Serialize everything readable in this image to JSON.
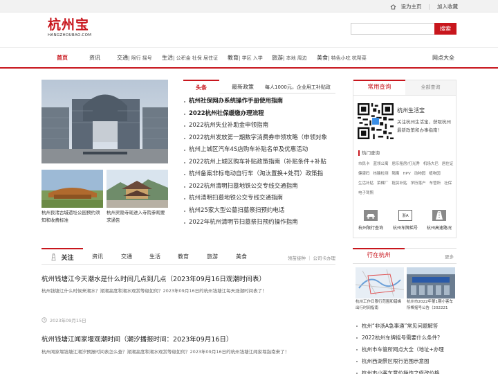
{
  "topbar": {
    "set_home": "设为主页",
    "add_fav": "加入收藏"
  },
  "logo": {
    "cn": "杭州宝",
    "en": "HANGZHOUBAO.COM"
  },
  "search": {
    "placeholder": "",
    "button": "搜索"
  },
  "nav": {
    "home": "首页",
    "news": "资讯",
    "traffic": "交通",
    "traffic_sub": "| 限行 摇号",
    "life": "生活",
    "life_sub": "| 公积金 社保 居住证",
    "edu": "教育",
    "edu_sub": "| 学区 入学",
    "travel": "旅游",
    "travel_sub": "| 本地 周边",
    "food": "美食",
    "food_sub": "| 特色小吃 杭帮菜",
    "sites": "网点大全"
  },
  "thumbs": [
    {
      "caption": "杭州良渚古城遗址公园预约须知和收费标准"
    },
    {
      "caption": "杭州灵隐寺现进入寺院参观要求通告"
    }
  ],
  "headline_tabs": {
    "active": "头条",
    "second": "最新政策",
    "sub": "每人1000元，企业用工补贴政"
  },
  "headlines": [
    {
      "text": "杭州社保网办系统操作手册使用指南",
      "bold": true
    },
    {
      "text": "2022杭州社保缓缴办理流程",
      "bold": true
    },
    {
      "text": "2022杭州失业补助金申领指南"
    },
    {
      "text": "2022杭州发放第一期数字消费券申领攻略（申领对象"
    },
    {
      "text": "杭州上城区汽车4S店购车补贴名单及优惠活动"
    },
    {
      "text": "2022杭州上城区购车补贴政策指南（补贴条件+补贴"
    },
    {
      "text": "杭州备案非标电动自行车（淘汰置换+处罚）政策指"
    },
    {
      "text": "2022杭州清明扫墓地铁公交专线交通指南"
    },
    {
      "text": "杭州清明扫墓地铁公交专线交通指南"
    },
    {
      "text": "杭州25家大型公墓扫墓祭扫预约电话"
    },
    {
      "text": "2022年杭州清明节扫墓祭扫预约操作指南"
    }
  ],
  "follow": {
    "active": "关注",
    "tabs": [
      "资讯",
      "交通",
      "生活",
      "教育",
      "旅游",
      "美食"
    ],
    "right": "领苗接种 ｜ 公司卡办理"
  },
  "articles": [
    {
      "title": "杭州钱塘江今天潮水是什么时间几点到几点（2023年09月16日观潮时间表）",
      "summary": "杭州钱塘江什么时候来潮水？潮潮高度和潮水观赏等级如何？2023年09月16日的杭州钱塘江每天涨潮时间表了！",
      "date": "2023年09月15日"
    },
    {
      "title": "杭州钱塘江闻家堰观潮时间（潮汐播报时间：2023年09月16日）",
      "summary": "杭州闻家堰钱塘江潮汐预报时间表怎么查？潮潮高度和潮水观赏等级如何？2023年09月16日的杭州钱塘江闻家堰指南来了！"
    }
  ],
  "sidebar": {
    "tab_active": "常用查询",
    "tab_other": "全部查询",
    "qr_title": "杭州生活宝",
    "qr_desc": "关注杭州生活宝，获取杭州最新政策和办事指南！",
    "hot_title": "热门查询",
    "hot": [
      "市民卡",
      "蓝领公寓",
      "居乐租房/打光秀",
      "机场大巴",
      "居住证",
      "健康码",
      "核酸检测",
      "隔离",
      "HPV",
      "动物园",
      "植物园",
      "生活补贴",
      "菜棵厂",
      "租赁补贴",
      "学历落户",
      "车管所",
      "社保",
      "电子驾照"
    ],
    "quick": [
      {
        "label": "杭州限行查询"
      },
      {
        "label": "杭州车牌摇号",
        "badge": "浙A"
      },
      {
        "label": "杭州高速路况"
      }
    ]
  },
  "city": {
    "tab": "行在杭州",
    "more": "更多",
    "images": [
      {
        "caption": "杭州工作日限行范围和错峰出行时间指南"
      },
      {
        "caption": "杭州市2022年第1期小客车所棒摇号公告（202221"
      }
    ],
    "list": [
      "杭州“非浙A急事通”常见问题解答",
      "2022杭州车牌摇号需要什么条件？",
      "杭州市车管所网点大全（地址+办理",
      "杭州西湖景区限行范围示意图",
      "杭州市小客车竞价操作之修改价格"
    ]
  },
  "colors": {
    "accent": "#c8161d"
  }
}
